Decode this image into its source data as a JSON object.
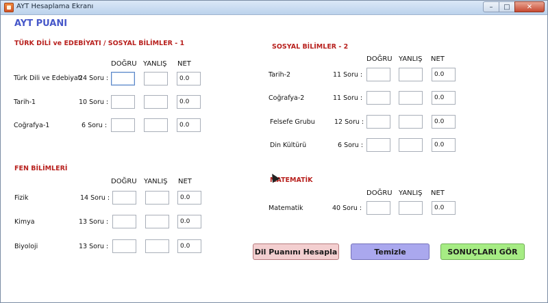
{
  "window": {
    "title": "AYT Hesaplama Ekranı",
    "min": "–",
    "max": "□",
    "close": "✕"
  },
  "main_title": "AYT PUANI",
  "sections": {
    "tde_sos1": {
      "title": "TÜRK DİLİ ve EDEBİYATI / SOSYAL BİLİMLER - 1",
      "headers": {
        "dogru": "DOĞRU",
        "yanlis": "YANLIŞ",
        "net": "NET"
      },
      "rows": [
        {
          "label": "Türk Dili ve Edebiyatı",
          "count": "24 Soru :",
          "dogru": "",
          "yanlis": "",
          "net": "0.0"
        },
        {
          "label": "Tarih-1",
          "count": "10 Soru :",
          "dogru": "",
          "yanlis": "",
          "net": "0.0"
        },
        {
          "label": "Coğrafya-1",
          "count": "6 Soru :",
          "dogru": "",
          "yanlis": "",
          "net": "0.0"
        }
      ]
    },
    "sos2": {
      "title": "SOSYAL BİLİMLER - 2",
      "headers": {
        "dogru": "DOĞRU",
        "yanlis": "YANLIŞ",
        "net": "NET"
      },
      "rows": [
        {
          "label": "Tarih-2",
          "count": "11 Soru :",
          "dogru": "",
          "yanlis": "",
          "net": "0.0"
        },
        {
          "label": "Coğrafya-2",
          "count": "11 Soru :",
          "dogru": "",
          "yanlis": "",
          "net": "0.0"
        },
        {
          "label": "Felsefe Grubu",
          "count": "12 Soru :",
          "dogru": "",
          "yanlis": "",
          "net": "0.0"
        },
        {
          "label": "Din Kültürü",
          "count": "6 Soru :",
          "dogru": "",
          "yanlis": "",
          "net": "0.0"
        }
      ]
    },
    "fen": {
      "title": "FEN BİLİMLERİ",
      "headers": {
        "dogru": "DOĞRU",
        "yanlis": "YANLIŞ",
        "net": "NET"
      },
      "rows": [
        {
          "label": "Fizik",
          "count": "14 Soru :",
          "dogru": "",
          "yanlis": "",
          "net": "0.0"
        },
        {
          "label": "Kimya",
          "count": "13 Soru  :",
          "dogru": "",
          "yanlis": "",
          "net": "0.0"
        },
        {
          "label": "Biyoloji",
          "count": "13 Soru :",
          "dogru": "",
          "yanlis": "",
          "net": "0.0"
        }
      ]
    },
    "mat": {
      "title": "MATEMATİK",
      "headers": {
        "dogru": "DOĞRU",
        "yanlis": "YANLIŞ",
        "net": "NET"
      },
      "rows": [
        {
          "label": "Matematik",
          "count": "40 Soru :",
          "dogru": "",
          "yanlis": "",
          "net": "0.0"
        }
      ]
    }
  },
  "buttons": {
    "dil": "Dil Puanını Hesapla",
    "temizle": "Temizle",
    "sonuclar": "SONUÇLARI GÖR"
  }
}
